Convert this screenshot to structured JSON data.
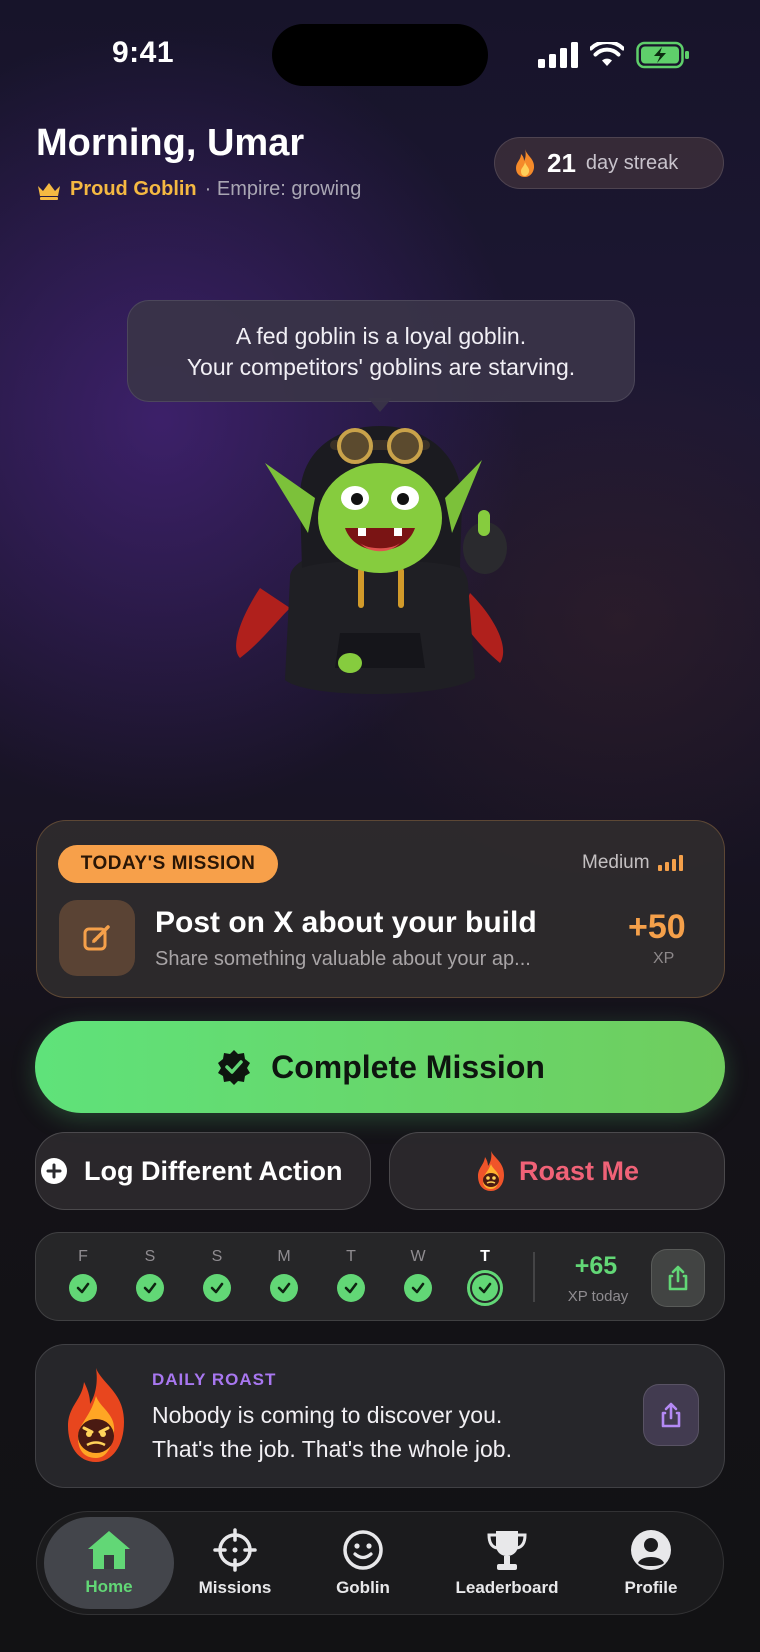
{
  "status_bar": {
    "time": "9:41"
  },
  "header": {
    "greeting": "Morning, Umar",
    "rank": "Proud Goblin",
    "empire": "· Empire: growing",
    "streak_count": "21",
    "streak_label": "day streak"
  },
  "bubble": {
    "line1": "A fed goblin is a loyal goblin.",
    "line2": "Your competitors' goblins are starving."
  },
  "mission": {
    "tag": "TODAY'S MISSION",
    "difficulty": "Medium",
    "title": "Post on X about your build",
    "subtitle": "Share something valuable about your ap...",
    "xp": "+50",
    "xp_label": "XP"
  },
  "actions": {
    "complete": "Complete Mission",
    "log_different": "Log Different Action",
    "roast_me": "Roast Me"
  },
  "week": {
    "days": [
      {
        "letter": "F",
        "done": true,
        "today": false
      },
      {
        "letter": "S",
        "done": true,
        "today": false
      },
      {
        "letter": "S",
        "done": true,
        "today": false
      },
      {
        "letter": "M",
        "done": true,
        "today": false
      },
      {
        "letter": "T",
        "done": true,
        "today": false
      },
      {
        "letter": "W",
        "done": true,
        "today": false
      },
      {
        "letter": "T",
        "done": true,
        "today": true
      }
    ],
    "xp_today_value": "+65",
    "xp_today_label": "XP today"
  },
  "daily_roast": {
    "kicker": "DAILY ROAST",
    "line1": "Nobody is coming to discover you.",
    "line2": "That's the job. That's the whole job."
  },
  "nav": {
    "items": [
      {
        "label": "Home",
        "icon": "home-icon",
        "active": true
      },
      {
        "label": "Missions",
        "icon": "crosshair-icon",
        "active": false
      },
      {
        "label": "Goblin",
        "icon": "smiley-icon",
        "active": false
      },
      {
        "label": "Leaderboard",
        "icon": "trophy-icon",
        "active": false
      },
      {
        "label": "Profile",
        "icon": "profile-icon",
        "active": false
      }
    ]
  },
  "colors": {
    "accent_green": "#62d776",
    "mission_orange": "#f7a04a",
    "roast_red": "#f06277",
    "roast_purple": "#a877f0",
    "rank_gold": "#f5b942"
  }
}
